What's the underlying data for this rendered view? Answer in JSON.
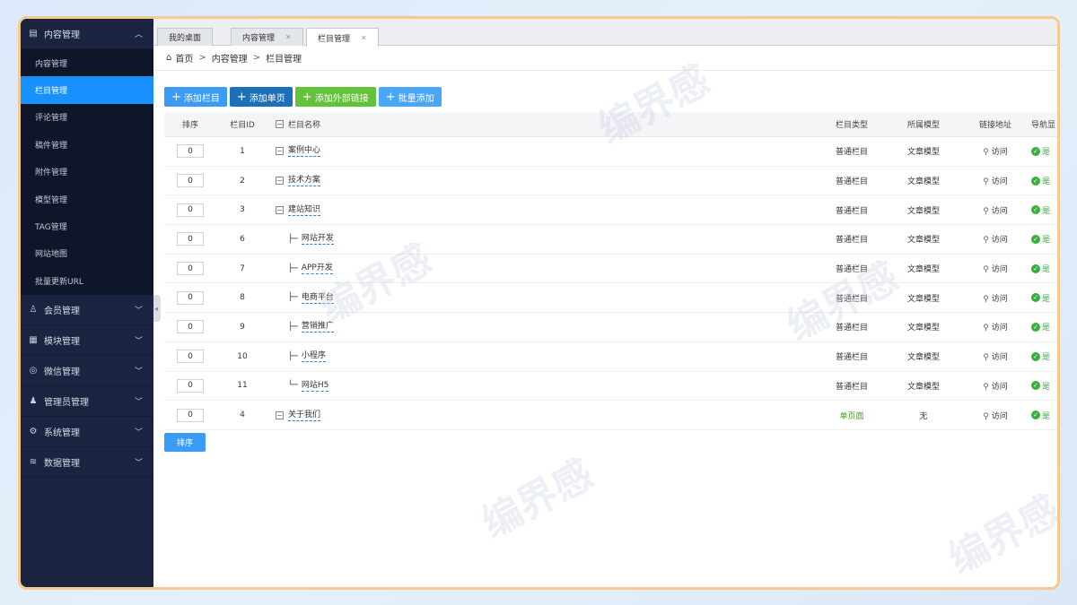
{
  "sidebar": {
    "groups": [
      {
        "label": "内容管理",
        "icon": "content-icon",
        "expanded": true,
        "items": [
          {
            "label": "内容管理",
            "active": false
          },
          {
            "label": "栏目管理",
            "active": true
          },
          {
            "label": "评论管理",
            "active": false
          },
          {
            "label": "稿件管理",
            "active": false
          },
          {
            "label": "附件管理",
            "active": false
          },
          {
            "label": "模型管理",
            "active": false
          },
          {
            "label": "TAG管理",
            "active": false
          },
          {
            "label": "网站地图",
            "active": false
          },
          {
            "label": "批量更新URL",
            "active": false
          }
        ]
      },
      {
        "label": "会员管理",
        "icon": "user-icon",
        "expanded": false
      },
      {
        "label": "模块管理",
        "icon": "grid-icon",
        "expanded": false
      },
      {
        "label": "微信管理",
        "icon": "wechat-icon",
        "expanded": false
      },
      {
        "label": "管理员管理",
        "icon": "admin-icon",
        "expanded": false
      },
      {
        "label": "系统管理",
        "icon": "gear-icon",
        "expanded": false
      },
      {
        "label": "数据管理",
        "icon": "database-icon",
        "expanded": false
      }
    ]
  },
  "tabs": [
    {
      "label": "我的桌面",
      "closable": false,
      "active": false
    },
    {
      "label": "内容管理",
      "closable": true,
      "active": false
    },
    {
      "label": "栏目管理",
      "closable": true,
      "active": true
    }
  ],
  "breadcrumb": {
    "home": "首页",
    "sep": ">",
    "level1": "内容管理",
    "level2": "栏目管理"
  },
  "toolbar": {
    "add_column": "添加栏目",
    "add_single": "添加单页",
    "add_external": "添加外部链接",
    "batch_add": "批量添加"
  },
  "table": {
    "headers": {
      "sort": "排序",
      "id": "栏目ID",
      "name": "栏目名称",
      "type": "栏目类型",
      "model": "所属模型",
      "link": "链接地址",
      "nav": "导航显"
    },
    "rows": [
      {
        "sort": "0",
        "id": "1",
        "name": "案例中心",
        "level": 0,
        "tree": "",
        "type": "普通栏目",
        "model": "文章模型",
        "link": "访问",
        "nav": "是"
      },
      {
        "sort": "0",
        "id": "2",
        "name": "技术方案",
        "level": 0,
        "tree": "",
        "type": "普通栏目",
        "model": "文章模型",
        "link": "访问",
        "nav": "是"
      },
      {
        "sort": "0",
        "id": "3",
        "name": "建站知识",
        "level": 0,
        "tree": "",
        "type": "普通栏目",
        "model": "文章模型",
        "link": "访问",
        "nav": "是"
      },
      {
        "sort": "0",
        "id": "6",
        "name": "网站开发",
        "level": 1,
        "tree": "├─",
        "type": "普通栏目",
        "model": "文章模型",
        "link": "访问",
        "nav": "是"
      },
      {
        "sort": "0",
        "id": "7",
        "name": "APP开发",
        "level": 1,
        "tree": "├─",
        "type": "普通栏目",
        "model": "文章模型",
        "link": "访问",
        "nav": "是"
      },
      {
        "sort": "0",
        "id": "8",
        "name": "电商平台",
        "level": 1,
        "tree": "├─",
        "type": "普通栏目",
        "model": "文章模型",
        "link": "访问",
        "nav": "是"
      },
      {
        "sort": "0",
        "id": "9",
        "name": "营销推广",
        "level": 1,
        "tree": "├─",
        "type": "普通栏目",
        "model": "文章模型",
        "link": "访问",
        "nav": "是"
      },
      {
        "sort": "0",
        "id": "10",
        "name": "小程序",
        "level": 1,
        "tree": "├─",
        "type": "普通栏目",
        "model": "文章模型",
        "link": "访问",
        "nav": "是"
      },
      {
        "sort": "0",
        "id": "11",
        "name": "网站H5",
        "level": 1,
        "tree": "└─",
        "type": "普通栏目",
        "model": "文章模型",
        "link": "访问",
        "nav": "是"
      },
      {
        "sort": "0",
        "id": "4",
        "name": "关于我们",
        "level": 0,
        "tree": "",
        "type": "单页面",
        "model": "无",
        "link": "访问",
        "nav": "是"
      }
    ]
  },
  "sort_button": "排序",
  "watermark": "编界感",
  "colors": {
    "sidebar_bg": "#1a2440",
    "accent": "#1890ff",
    "green": "#62c23a",
    "frame_border": "#f6c98f"
  }
}
